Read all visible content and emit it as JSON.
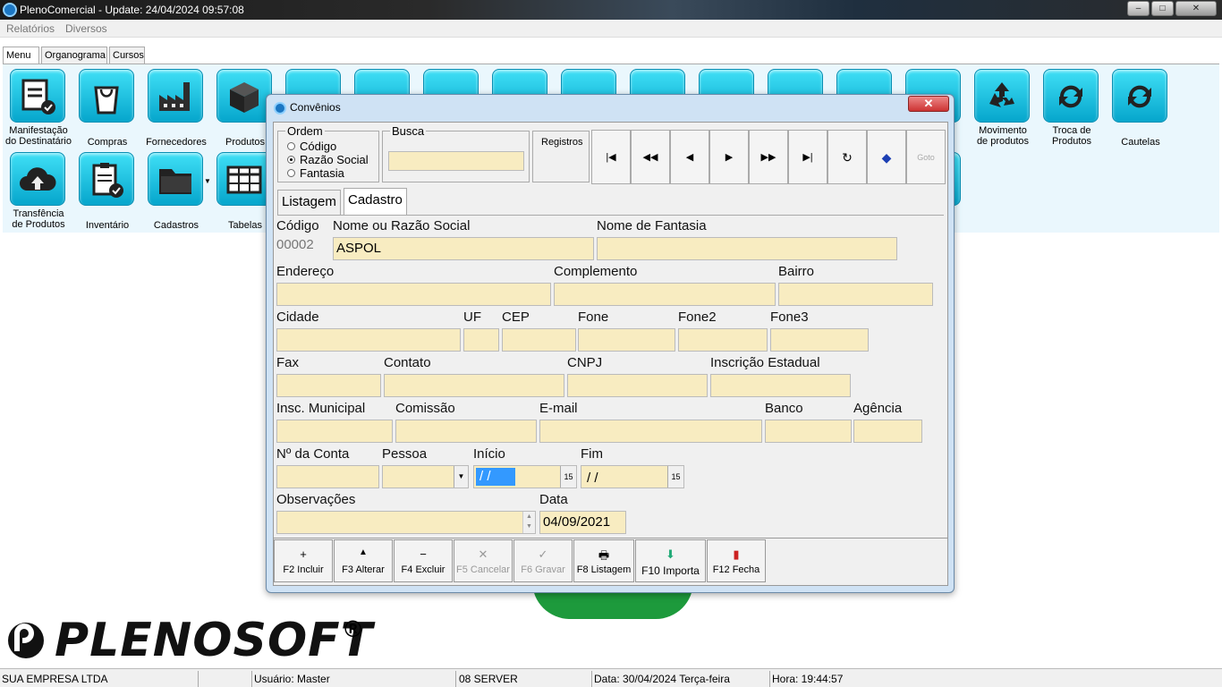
{
  "window": {
    "title": "PlenoComercial - Update: 24/04/2024 09:57:08"
  },
  "menubar": {
    "items": [
      "Relatórios",
      "Diversos"
    ]
  },
  "tabs": [
    "Menu",
    "Organograma",
    "Cursos"
  ],
  "toolbar_row1": [
    {
      "label": "Manifestação\ndo Destinatário",
      "icon": "document-check-icon"
    },
    {
      "label": "Compras",
      "icon": "shopping-bag-icon"
    },
    {
      "label": "Fornecedores",
      "icon": "factory-icon"
    },
    {
      "label": "Produtos",
      "icon": "box-icon"
    },
    {
      "label": "Movimento\nde produtos",
      "icon": "recycle-icon"
    },
    {
      "label": "Troca de\nProdutos",
      "icon": "swap-icon"
    },
    {
      "label": "Cautelas",
      "icon": "swap-icon"
    }
  ],
  "toolbar_row2": [
    {
      "label": "Transfência\nde Produtos",
      "icon": "cloud-upload-icon"
    },
    {
      "label": "Inventário",
      "icon": "clipboard-check-icon"
    },
    {
      "label": "Cadastros",
      "icon": "folder-icon"
    },
    {
      "label": "Tabelas",
      "icon": "table-icon"
    }
  ],
  "brand": {
    "logo_text": "PLENOSOFT",
    "registered": "®"
  },
  "status": {
    "company": "SUA EMPRESA LTDA",
    "user": "Usuário: Master",
    "server": "08 SERVER",
    "date": "Data: 30/04/2024 Terça-feira",
    "time": "Hora: 19:44:57"
  },
  "dialog": {
    "title": "Convênios",
    "close": "✕",
    "ordem": {
      "caption": "Ordem",
      "options": [
        "Código",
        "Razão Social",
        "Fantasia"
      ],
      "selected": "Razão Social"
    },
    "busca": {
      "caption": "Busca",
      "value": ""
    },
    "registros_label": "Registros",
    "tabs": [
      "Listagem",
      "Cadastro"
    ],
    "active_tab": "Cadastro",
    "fields": {
      "codigo": {
        "label": "Código",
        "value": "00002"
      },
      "nome": {
        "label": "Nome ou Razão Social",
        "value": "ASPOL"
      },
      "fantasia": {
        "label": "Nome de Fantasia",
        "value": ""
      },
      "endereco": {
        "label": "Endereço",
        "value": ""
      },
      "complemento": {
        "label": "Complemento",
        "value": ""
      },
      "bairro": {
        "label": "Bairro",
        "value": ""
      },
      "cidade": {
        "label": "Cidade",
        "value": ""
      },
      "uf": {
        "label": "UF",
        "value": ""
      },
      "cep": {
        "label": "CEP",
        "value": ""
      },
      "fone": {
        "label": "Fone",
        "value": ""
      },
      "fone2": {
        "label": "Fone2",
        "value": ""
      },
      "fone3": {
        "label": "Fone3",
        "value": ""
      },
      "fax": {
        "label": "Fax",
        "value": ""
      },
      "contato": {
        "label": "Contato",
        "value": ""
      },
      "cnpj": {
        "label": "CNPJ",
        "value": ""
      },
      "ie": {
        "label": "Inscrição Estadual",
        "value": ""
      },
      "im": {
        "label": "Insc. Municipal",
        "value": ""
      },
      "comissao": {
        "label": "Comissão",
        "value": ""
      },
      "email": {
        "label": "E-mail",
        "value": ""
      },
      "banco": {
        "label": "Banco",
        "value": ""
      },
      "agencia": {
        "label": "Agência",
        "value": ""
      },
      "conta": {
        "label": "Nº da Conta",
        "value": ""
      },
      "pessoa": {
        "label": "Pessoa",
        "value": ""
      },
      "inicio": {
        "label": "Início",
        "value": " / /"
      },
      "fim": {
        "label": "Fim",
        "value": " / /"
      },
      "obs": {
        "label": "Observações",
        "value": ""
      },
      "data": {
        "label": "Data",
        "value": "04/09/2021"
      }
    },
    "buttons": [
      {
        "label": "F2 Incluir",
        "icon": "+"
      },
      {
        "label": "F3 Alterar",
        "icon": "▲"
      },
      {
        "label": "F4 Excluir",
        "icon": "−"
      },
      {
        "label": "F5 Cancelar",
        "icon": "✕"
      },
      {
        "label": "F6 Gravar",
        "icon": "✓"
      },
      {
        "label": "F8 Listagem",
        "icon": "🖶"
      },
      {
        "label": "F10 Importa",
        "icon": "⬇"
      },
      {
        "label": "F12 Fecha",
        "icon": "▮"
      }
    ]
  }
}
